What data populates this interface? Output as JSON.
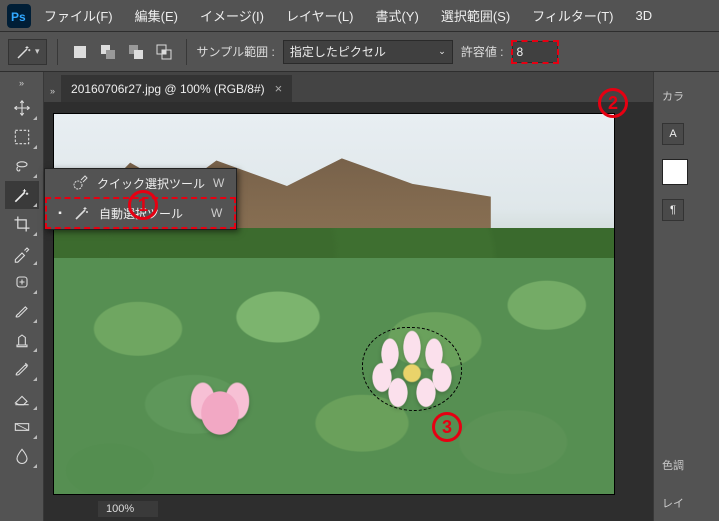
{
  "menu": {
    "file": "ファイル(F)",
    "edit": "編集(E)",
    "image": "イメージ(I)",
    "layer": "レイヤー(L)",
    "type": "書式(Y)",
    "select": "選択範囲(S)",
    "filter": "フィルター(T)",
    "threeD": "3D"
  },
  "options": {
    "sample_label": "サンプル範囲 :",
    "sample_value": "指定したピクセル",
    "tolerance_label": "許容値 :",
    "tolerance_value": "8"
  },
  "document": {
    "tab_title": "20160706r27.jpg @ 100% (RGB/8#)",
    "zoom": "100%"
  },
  "flyout": {
    "quick": {
      "label": "クイック選択ツール",
      "key": "W"
    },
    "magic": {
      "label": "自動選択ツール",
      "key": "W"
    }
  },
  "markers": {
    "m1": "1",
    "m2": "2",
    "m3": "3"
  },
  "right": {
    "glyph_A": "A",
    "para": "¶",
    "color_adjust": "カラ",
    "tone": "色調",
    "layers": "レイ"
  }
}
